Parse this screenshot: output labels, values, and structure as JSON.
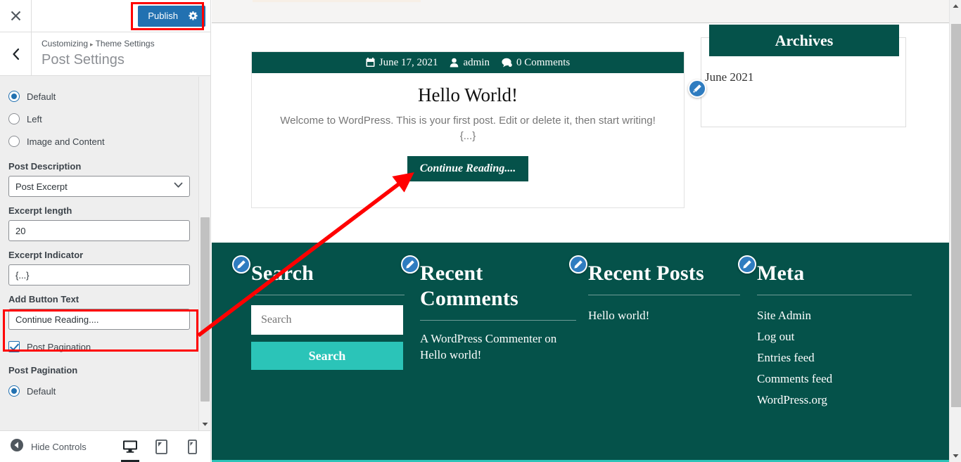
{
  "customizer": {
    "close_icon": "close-icon",
    "back_icon": "chevron-left-icon",
    "publish_label": "Publish",
    "publish_gear_icon": "gear-icon",
    "breadcrumb_root": "Customizing",
    "breadcrumb_separator": "▸",
    "breadcrumb_parent": "Theme Settings",
    "section_title": "Post Settings",
    "layout_options": [
      {
        "label": "Default",
        "checked": true
      },
      {
        "label": "Left",
        "checked": false
      },
      {
        "label": "Image and Content",
        "checked": false
      }
    ],
    "post_description": {
      "label": "Post Description",
      "value": "Post Excerpt",
      "caret_icon": "chevron-down-icon"
    },
    "excerpt_length": {
      "label": "Excerpt length",
      "value": "20"
    },
    "excerpt_indicator": {
      "label": "Excerpt Indicator",
      "value": "{...}"
    },
    "add_button_text": {
      "label": "Add Button Text",
      "value": "Continue Reading...."
    },
    "post_pagination_checkbox": {
      "label": "Post Pagination",
      "checked": true
    },
    "post_pagination_group": {
      "label": "Post Pagination",
      "options": [
        {
          "label": "Default",
          "checked": true
        }
      ]
    },
    "footer": {
      "hide_controls_label": "Hide Controls",
      "hide_controls_icon": "collapse-left-icon",
      "devices": [
        {
          "name": "desktop",
          "icon": "desktop-icon",
          "active": true
        },
        {
          "name": "tablet",
          "icon": "tablet-icon",
          "active": false
        },
        {
          "name": "mobile",
          "icon": "mobile-icon",
          "active": false
        }
      ]
    }
  },
  "annotations": {
    "highlight_color": "#ff0000",
    "arrow_color": "#ff0000",
    "boxes": [
      "publish-button",
      "add-button-text-field"
    ]
  },
  "preview": {
    "post": {
      "date": "June 17, 2021",
      "date_icon": "calendar-icon",
      "author": "admin",
      "author_icon": "user-icon",
      "comments": "0 Comments",
      "comments_icon": "comment-icon",
      "title": "Hello World!",
      "excerpt": "Welcome to WordPress. This is your first post. Edit or delete it, then start writing! {...}",
      "button_label": "Continue Reading...."
    },
    "archives_widget": {
      "title": "Archives",
      "items": [
        "June 2021"
      ],
      "edit_icon": "edit-pencil-icon"
    },
    "footer_widgets": [
      {
        "title": "Search",
        "edit_icon": "edit-pencil-icon",
        "search_placeholder": "Search",
        "search_button_label": "Search"
      },
      {
        "title": "Recent Comments",
        "edit_icon": "edit-pencil-icon",
        "text": "A WordPress Commenter on Hello world!"
      },
      {
        "title": "Recent Posts",
        "edit_icon": "edit-pencil-icon",
        "items": [
          "Hello world!"
        ]
      },
      {
        "title": "Meta",
        "edit_icon": "edit-pencil-icon",
        "items": [
          "Site Admin",
          "Log out",
          "Entries feed",
          "Comments feed",
          "WordPress.org"
        ]
      }
    ]
  },
  "colors": {
    "brand_dark_teal": "#05524a",
    "brand_turquoise": "#2bc4b8",
    "publish_blue": "#2271b1",
    "edit_icon_blue": "#2f7cc0",
    "annotation_red": "#ff0000"
  }
}
